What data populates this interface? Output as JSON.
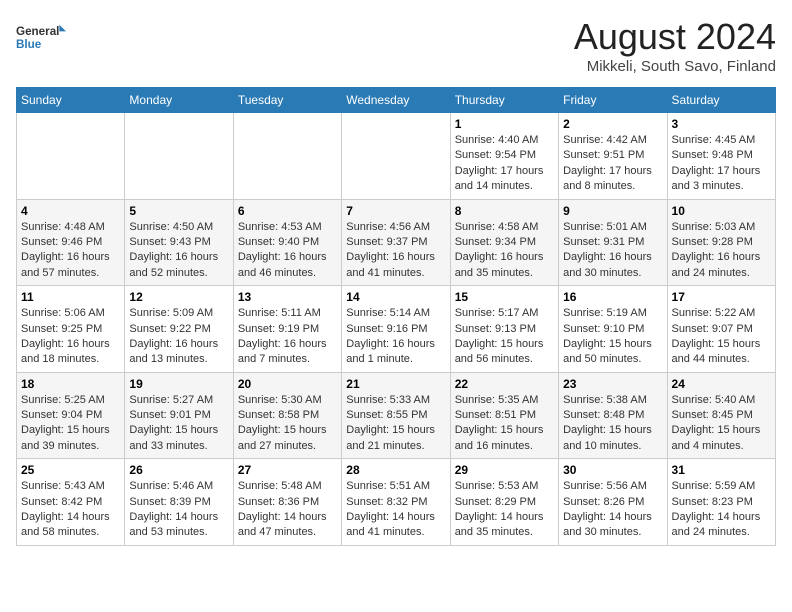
{
  "logo": {
    "text_general": "General",
    "text_blue": "Blue"
  },
  "title": "August 2024",
  "subtitle": "Mikkeli, South Savo, Finland",
  "weekdays": [
    "Sunday",
    "Monday",
    "Tuesday",
    "Wednesday",
    "Thursday",
    "Friday",
    "Saturday"
  ],
  "weeks": [
    [
      {
        "day": "",
        "info": ""
      },
      {
        "day": "",
        "info": ""
      },
      {
        "day": "",
        "info": ""
      },
      {
        "day": "",
        "info": ""
      },
      {
        "day": "1",
        "info": "Sunrise: 4:40 AM\nSunset: 9:54 PM\nDaylight: 17 hours\nand 14 minutes."
      },
      {
        "day": "2",
        "info": "Sunrise: 4:42 AM\nSunset: 9:51 PM\nDaylight: 17 hours\nand 8 minutes."
      },
      {
        "day": "3",
        "info": "Sunrise: 4:45 AM\nSunset: 9:48 PM\nDaylight: 17 hours\nand 3 minutes."
      }
    ],
    [
      {
        "day": "4",
        "info": "Sunrise: 4:48 AM\nSunset: 9:46 PM\nDaylight: 16 hours\nand 57 minutes."
      },
      {
        "day": "5",
        "info": "Sunrise: 4:50 AM\nSunset: 9:43 PM\nDaylight: 16 hours\nand 52 minutes."
      },
      {
        "day": "6",
        "info": "Sunrise: 4:53 AM\nSunset: 9:40 PM\nDaylight: 16 hours\nand 46 minutes."
      },
      {
        "day": "7",
        "info": "Sunrise: 4:56 AM\nSunset: 9:37 PM\nDaylight: 16 hours\nand 41 minutes."
      },
      {
        "day": "8",
        "info": "Sunrise: 4:58 AM\nSunset: 9:34 PM\nDaylight: 16 hours\nand 35 minutes."
      },
      {
        "day": "9",
        "info": "Sunrise: 5:01 AM\nSunset: 9:31 PM\nDaylight: 16 hours\nand 30 minutes."
      },
      {
        "day": "10",
        "info": "Sunrise: 5:03 AM\nSunset: 9:28 PM\nDaylight: 16 hours\nand 24 minutes."
      }
    ],
    [
      {
        "day": "11",
        "info": "Sunrise: 5:06 AM\nSunset: 9:25 PM\nDaylight: 16 hours\nand 18 minutes."
      },
      {
        "day": "12",
        "info": "Sunrise: 5:09 AM\nSunset: 9:22 PM\nDaylight: 16 hours\nand 13 minutes."
      },
      {
        "day": "13",
        "info": "Sunrise: 5:11 AM\nSunset: 9:19 PM\nDaylight: 16 hours\nand 7 minutes."
      },
      {
        "day": "14",
        "info": "Sunrise: 5:14 AM\nSunset: 9:16 PM\nDaylight: 16 hours\nand 1 minute."
      },
      {
        "day": "15",
        "info": "Sunrise: 5:17 AM\nSunset: 9:13 PM\nDaylight: 15 hours\nand 56 minutes."
      },
      {
        "day": "16",
        "info": "Sunrise: 5:19 AM\nSunset: 9:10 PM\nDaylight: 15 hours\nand 50 minutes."
      },
      {
        "day": "17",
        "info": "Sunrise: 5:22 AM\nSunset: 9:07 PM\nDaylight: 15 hours\nand 44 minutes."
      }
    ],
    [
      {
        "day": "18",
        "info": "Sunrise: 5:25 AM\nSunset: 9:04 PM\nDaylight: 15 hours\nand 39 minutes."
      },
      {
        "day": "19",
        "info": "Sunrise: 5:27 AM\nSunset: 9:01 PM\nDaylight: 15 hours\nand 33 minutes."
      },
      {
        "day": "20",
        "info": "Sunrise: 5:30 AM\nSunset: 8:58 PM\nDaylight: 15 hours\nand 27 minutes."
      },
      {
        "day": "21",
        "info": "Sunrise: 5:33 AM\nSunset: 8:55 PM\nDaylight: 15 hours\nand 21 minutes."
      },
      {
        "day": "22",
        "info": "Sunrise: 5:35 AM\nSunset: 8:51 PM\nDaylight: 15 hours\nand 16 minutes."
      },
      {
        "day": "23",
        "info": "Sunrise: 5:38 AM\nSunset: 8:48 PM\nDaylight: 15 hours\nand 10 minutes."
      },
      {
        "day": "24",
        "info": "Sunrise: 5:40 AM\nSunset: 8:45 PM\nDaylight: 15 hours\nand 4 minutes."
      }
    ],
    [
      {
        "day": "25",
        "info": "Sunrise: 5:43 AM\nSunset: 8:42 PM\nDaylight: 14 hours\nand 58 minutes."
      },
      {
        "day": "26",
        "info": "Sunrise: 5:46 AM\nSunset: 8:39 PM\nDaylight: 14 hours\nand 53 minutes."
      },
      {
        "day": "27",
        "info": "Sunrise: 5:48 AM\nSunset: 8:36 PM\nDaylight: 14 hours\nand 47 minutes."
      },
      {
        "day": "28",
        "info": "Sunrise: 5:51 AM\nSunset: 8:32 PM\nDaylight: 14 hours\nand 41 minutes."
      },
      {
        "day": "29",
        "info": "Sunrise: 5:53 AM\nSunset: 8:29 PM\nDaylight: 14 hours\nand 35 minutes."
      },
      {
        "day": "30",
        "info": "Sunrise: 5:56 AM\nSunset: 8:26 PM\nDaylight: 14 hours\nand 30 minutes."
      },
      {
        "day": "31",
        "info": "Sunrise: 5:59 AM\nSunset: 8:23 PM\nDaylight: 14 hours\nand 24 minutes."
      }
    ]
  ]
}
